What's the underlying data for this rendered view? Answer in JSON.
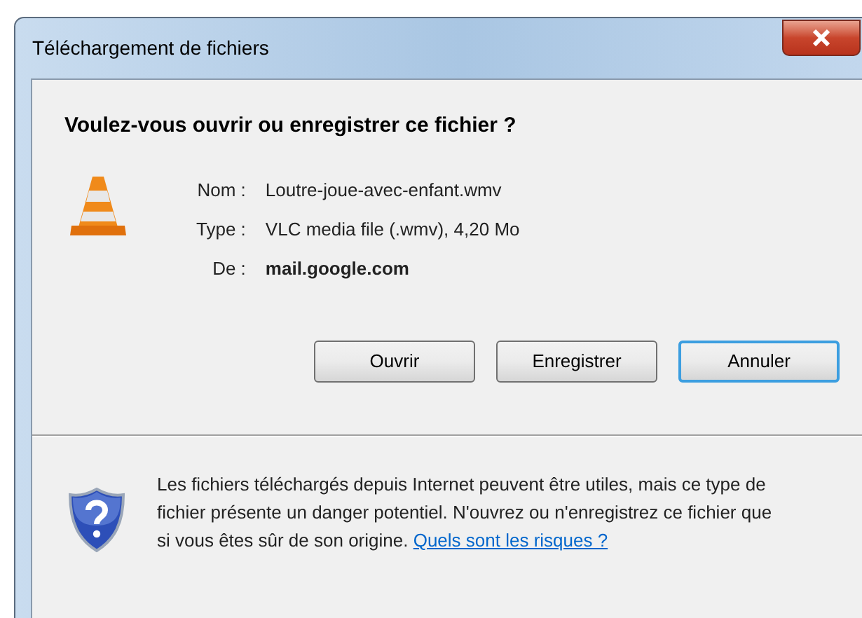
{
  "window": {
    "title": "Téléchargement de fichiers"
  },
  "heading": "Voulez-vous ouvrir ou enregistrer ce fichier ?",
  "fields": [
    {
      "label": "Nom :",
      "value": "Loutre-joue-avec-enfant.wmv",
      "bold": false
    },
    {
      "label": "Type :",
      "value": "VLC media file (.wmv), 4,20 Mo",
      "bold": false
    },
    {
      "label": "De :",
      "value": "mail.google.com",
      "bold": true
    }
  ],
  "buttons": [
    {
      "label": "Ouvrir",
      "default": false
    },
    {
      "label": "Enregistrer",
      "default": false
    },
    {
      "label": "Annuler",
      "default": true
    }
  ],
  "warning": {
    "text": "Les fichiers téléchargés depuis Internet peuvent être utiles, mais ce type de fichier présente un danger potentiel. N'ouvrez ou n'enregistrez ce fichier que si vous êtes sûr de son origine.",
    "link": "Quels sont les risques ?"
  }
}
